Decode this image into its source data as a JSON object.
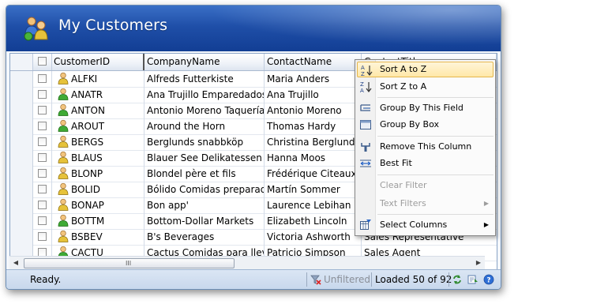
{
  "window": {
    "title": "My Customers"
  },
  "grid": {
    "columns": [
      "CustomerID",
      "CompanyName",
      "ContactName",
      "ContactTitle"
    ],
    "rows": [
      {
        "id": "ALFKI",
        "company": "Alfreds Futterkiste",
        "contact": "Maria Anders",
        "title": "",
        "gender": "female"
      },
      {
        "id": "ANATR",
        "company": "Ana Trujillo Emparedados...",
        "contact": "Ana Trujillo",
        "title": "",
        "gender": "male"
      },
      {
        "id": "ANTON",
        "company": "Antonio Moreno Taquería",
        "contact": "Antonio Moreno",
        "title": "",
        "gender": "male"
      },
      {
        "id": "AROUT",
        "company": "Around the Horn",
        "contact": "Thomas Hardy",
        "title": "",
        "gender": "male"
      },
      {
        "id": "BERGS",
        "company": "Berglunds snabbköp",
        "contact": "Christina Berglund",
        "title": "",
        "gender": "female"
      },
      {
        "id": "BLAUS",
        "company": "Blauer See Delikatessen",
        "contact": "Hanna Moos",
        "title": "",
        "gender": "female"
      },
      {
        "id": "BLONP",
        "company": "Blondel père et fils",
        "contact": "Frédérique Citeaux",
        "title": "",
        "gender": "female"
      },
      {
        "id": "BOLID",
        "company": "Bólido Comidas preparadas",
        "contact": "Martín Sommer",
        "title": "",
        "gender": "female"
      },
      {
        "id": "BONAP",
        "company": "Bon app'",
        "contact": "Laurence Lebihan",
        "title": "",
        "gender": "female"
      },
      {
        "id": "BOTTM",
        "company": "Bottom-Dollar Markets",
        "contact": "Elizabeth Lincoln",
        "title": "",
        "gender": "male"
      },
      {
        "id": "BSBEV",
        "company": "B's Beverages",
        "contact": "Victoria Ashworth",
        "title": "Sales Representative",
        "gender": "female"
      },
      {
        "id": "CACTU",
        "company": "Cactus Comidas para llevar",
        "contact": "Patricio Simpson",
        "title": "Sales Agent",
        "gender": "male"
      }
    ]
  },
  "context_menu": {
    "items": [
      {
        "label": "Sort A to Z",
        "icon": "sort-ascending-icon",
        "enabled": true,
        "highlighted": true
      },
      {
        "label": "Sort Z to A",
        "icon": "sort-descending-icon",
        "enabled": true
      },
      {
        "label": "Group By This Field",
        "icon": "group-by-field-icon",
        "enabled": true
      },
      {
        "label": "Group By Box",
        "icon": "group-by-box-icon",
        "enabled": true
      },
      {
        "label": "Remove This Column",
        "icon": "remove-column-icon",
        "enabled": true
      },
      {
        "label": "Best Fit",
        "icon": "best-fit-icon",
        "enabled": true
      },
      {
        "label": "Clear Filter",
        "icon": "",
        "enabled": false
      },
      {
        "label": "Text Filters",
        "icon": "",
        "enabled": false,
        "submenu": true
      },
      {
        "label": "Select Columns",
        "icon": "select-columns-icon",
        "enabled": true,
        "submenu": true
      }
    ]
  },
  "scrollbar": {
    "grip": "III"
  },
  "statusbar": {
    "status": "Ready.",
    "filter": "Unfiltered",
    "loaded": "Loaded 50 of 92"
  },
  "colors": {
    "title_gradient_top": "#3a6fc6",
    "title_gradient_bottom": "#123e94",
    "highlight": "#ffe8a8"
  }
}
